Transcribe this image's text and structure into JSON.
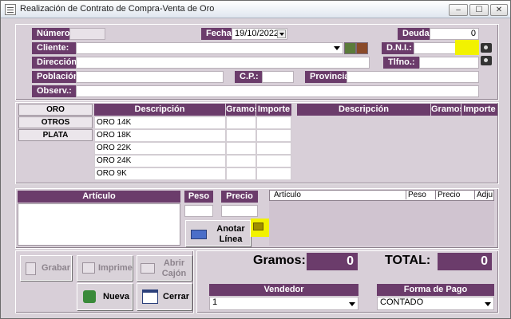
{
  "window": {
    "title": "Realización de Contrato de Compra-Venta de Oro",
    "min": "–",
    "max": "☐",
    "close": "✕"
  },
  "header": {
    "numero_label": "Número:",
    "numero_value": "",
    "fecha_label": "Fecha:",
    "fecha_value": "19/10/2022",
    "deuda_label": "Deuda",
    "deuda_value": "0",
    "cliente_label": "Cliente:",
    "cliente_value": "",
    "dni_label": "D.N.I.:",
    "dni_value": "",
    "direccion_label": "Dirección:",
    "direccion_value": "",
    "tlfno_label": "Tlfno.:",
    "tlfno_value": "",
    "poblacion_label": "Población:",
    "poblacion_value": "",
    "cp_label": "C.P.:",
    "cp_value": "",
    "provincia_label": "Provincia:",
    "provincia_value": "",
    "observ_label": "Observ.:",
    "observ_value": ""
  },
  "metal_tabs": [
    "ORO",
    "OTROS",
    "PLATA"
  ],
  "left_table": {
    "columns": [
      "Descripción",
      "Gramos",
      "Importe"
    ],
    "rows": [
      "ORO 14K",
      "ORO 18K",
      "ORO 22K",
      "ORO 24K",
      "ORO 9K"
    ]
  },
  "right_table": {
    "columns": [
      "Descripción",
      "Gramos",
      "Importe"
    ]
  },
  "articulo": {
    "articulo_label": "Artículo",
    "peso_label": "Peso",
    "precio_label": "Precio",
    "anotar_label": "Anotar Línea",
    "lines_columns": [
      "Artículo",
      "Peso",
      "Precio",
      "Adju"
    ]
  },
  "actions": {
    "grabar": "Grabar",
    "imprime": "Imprime",
    "abrir_cajon": "Abrir Cajón",
    "nueva": "Nueva",
    "cerrar": "Cerrar"
  },
  "totals": {
    "gramos_label": "Gramos:",
    "gramos_value": "0",
    "total_label": "TOTAL:",
    "total_value": "0"
  },
  "vendedor": {
    "label": "Vendedor",
    "value": "1"
  },
  "forma_pago": {
    "label": "Forma de Pago",
    "value": "CONTADO"
  },
  "colors": {
    "accent": "#6b3c6b",
    "highlight": "#f2f200"
  }
}
